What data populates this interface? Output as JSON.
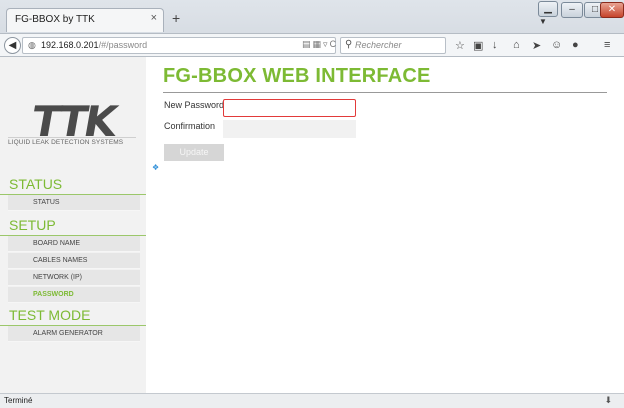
{
  "browser": {
    "tab_title": "FG-BBOX by TTK",
    "tab_close": "×",
    "new_tab": "+",
    "url_host": "192.168.0.201",
    "url_path": "/#/password",
    "search_placeholder": "Rechercher",
    "status_text": "Terminé"
  },
  "sidebar": {
    "logo": "TTK",
    "tagline": "LIQUID LEAK DETECTION SYSTEMS",
    "sections": [
      {
        "title": "STATUS",
        "items": [
          "STATUS"
        ]
      },
      {
        "title": "SETUP",
        "items": [
          "BOARD NAME",
          "CABLES NAMES",
          "NETWORK (IP)",
          "PASSWORD"
        ]
      },
      {
        "title": "TEST MODE",
        "items": [
          "ALARM GENERATOR"
        ]
      }
    ],
    "active_item": "PASSWORD"
  },
  "main": {
    "title": "FG-BBOX WEB INTERFACE",
    "new_password_label": "New Password",
    "confirmation_label": "Confirmation",
    "new_password_value": "",
    "confirmation_value": "",
    "update_label": "Update"
  },
  "colors": {
    "accent": "#7dba34",
    "focus_border": "#e23a3a"
  }
}
